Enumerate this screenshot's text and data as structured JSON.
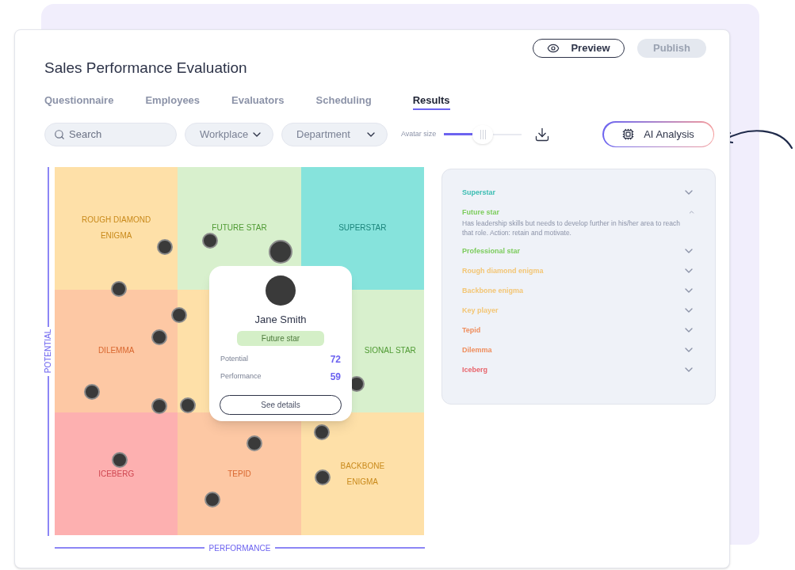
{
  "title": "Sales Performance Evaluation",
  "actions": [
    {
      "label": "Preview",
      "kind": "outline",
      "disabled": false
    },
    {
      "label": "Publish",
      "kind": "solid",
      "disabled": true
    }
  ],
  "tabs": [
    {
      "label": "Questionnaire",
      "selected": false
    },
    {
      "label": "Employees",
      "selected": false
    },
    {
      "label": "Evaluators",
      "selected": false
    },
    {
      "label": "Scheduling",
      "selected": false
    },
    {
      "label": "Results",
      "selected": true
    }
  ],
  "filters": {
    "search": {
      "placeholder": "Search"
    },
    "dropdowns": [
      {
        "label": "Workplace"
      },
      {
        "label": "Department"
      }
    ],
    "avatar_size": {
      "label": "Avatar size",
      "level": 0.5
    }
  },
  "ai_button": {
    "label": "AI Analysis"
  },
  "matrix": {
    "y_axis": "POTENTIAL",
    "x_axis": "PERFORMANCE",
    "cells": [
      {
        "label_lines": [
          "ROUGH DIAMOND",
          "ENIGMA"
        ],
        "color": "#fee0a8"
      },
      {
        "label_lines": [
          "FUTURE STAR"
        ],
        "color": "#d8f0cd"
      },
      {
        "label_lines": [
          "SUPERSTAR"
        ],
        "color": "#86e3dc"
      },
      {
        "label_lines": [
          "DILEMMA"
        ],
        "color": "#fdc8a4"
      },
      {
        "color": "#fee0a8"
      },
      {
        "label_lines": [
          "SIONAL STAR"
        ],
        "color": "#d8f0cd"
      },
      {
        "label_lines": [
          "ICEBERG"
        ],
        "color": "#fdb0b0"
      },
      {
        "label_lines": [
          "TEPID"
        ],
        "color": "#fdc8a4"
      },
      {
        "label_lines": [
          "BACKBONE",
          "ENIGMA"
        ],
        "color": "#fee0a8"
      }
    ],
    "popup": {
      "name": "Jane Smith",
      "category": "Future star",
      "metrics": [
        {
          "label": "Potential",
          "value": "72"
        },
        {
          "label": "Performance",
          "value": "59"
        }
      ],
      "button": "See details"
    }
  },
  "legend": [
    {
      "label": "Superstar",
      "color": "#3bbdb2",
      "expanded": false
    },
    {
      "label": "Future star",
      "color": "#7ccc5c",
      "expanded": true,
      "description": "Has leadership skills but needs to develop further in his/her area to reach that role. Action: retain and motivate."
    },
    {
      "label": "Professional star",
      "color": "#7ccc5c",
      "expanded": false
    },
    {
      "label": "Rough diamond enigma",
      "color": "#f3c675",
      "expanded": false
    },
    {
      "label": "Backbone enigma",
      "color": "#f3c675",
      "expanded": false
    },
    {
      "label": "Key player",
      "color": "#f3c675",
      "expanded": false
    },
    {
      "label": "Tepid",
      "color": "#ef8d5c",
      "expanded": false
    },
    {
      "label": "Dilemma",
      "color": "#ef8d5c",
      "expanded": false
    },
    {
      "label": "Iceberg",
      "color": "#e8666d",
      "expanded": false
    }
  ]
}
